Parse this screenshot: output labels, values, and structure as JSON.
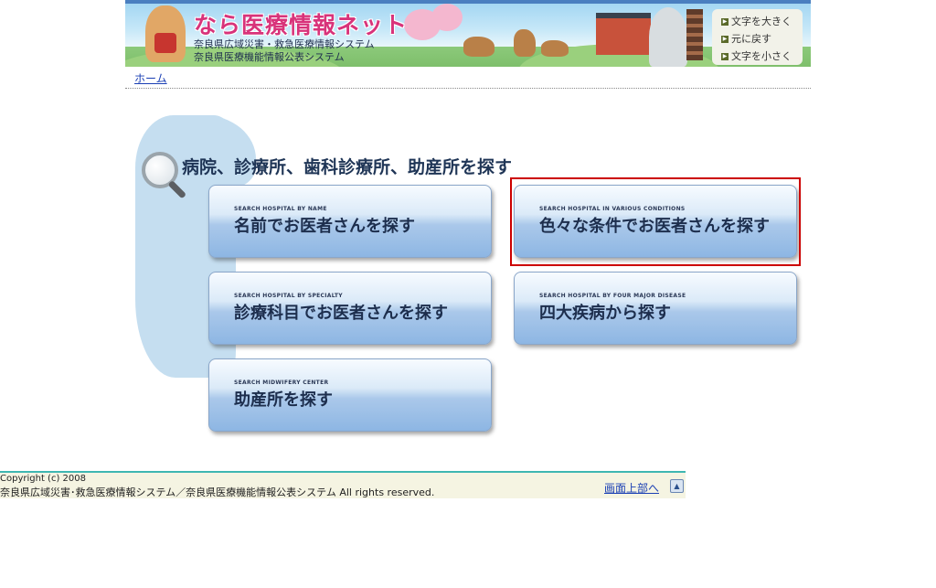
{
  "header": {
    "site_title": "なら医療情報ネット",
    "subtitle_1": "奈良県広域災害・救急医療情報システム",
    "subtitle_2": "奈良県医療機能情報公表システム",
    "font_controls": {
      "larger": "文字を大きく",
      "reset": "元に戻す",
      "smaller": "文字を小さく"
    }
  },
  "breadcrumb": {
    "home": "ホーム"
  },
  "main": {
    "section_title": "病院、診療所、歯科診療所、助産所を探す",
    "buttons": [
      {
        "en": "SEARCH HOSPITAL BY NAME",
        "ja": "名前でお医者さんを探す"
      },
      {
        "en": "SEARCH HOSPITAL IN VARIOUS CONDITIONS",
        "ja": "色々な条件でお医者さんを探す"
      },
      {
        "en": "SEARCH HOSPITAL BY SPECIALTY",
        "ja": "診療科目でお医者さんを探す"
      },
      {
        "en": "SEARCH HOSPITAL BY FOUR MAJOR DISEASE",
        "ja": "四大疾病から探す"
      },
      {
        "en": "SEARCH MIDWIFERY CENTER",
        "ja": "助産所を探す"
      }
    ]
  },
  "footer": {
    "copyright": "Copyright (c) 2008",
    "rights": "奈良県広域災害･救急医療情報システム／奈良県医療機能情報公表システム All rights reserved.",
    "to_top": "画面上部へ",
    "to_top_icon": "up-arrow-icon"
  },
  "colors": {
    "title_pink": "#d8337a",
    "highlight_red": "#cc0000",
    "footer_line": "#3fb7b2",
    "link_blue": "#1a3fb4"
  }
}
